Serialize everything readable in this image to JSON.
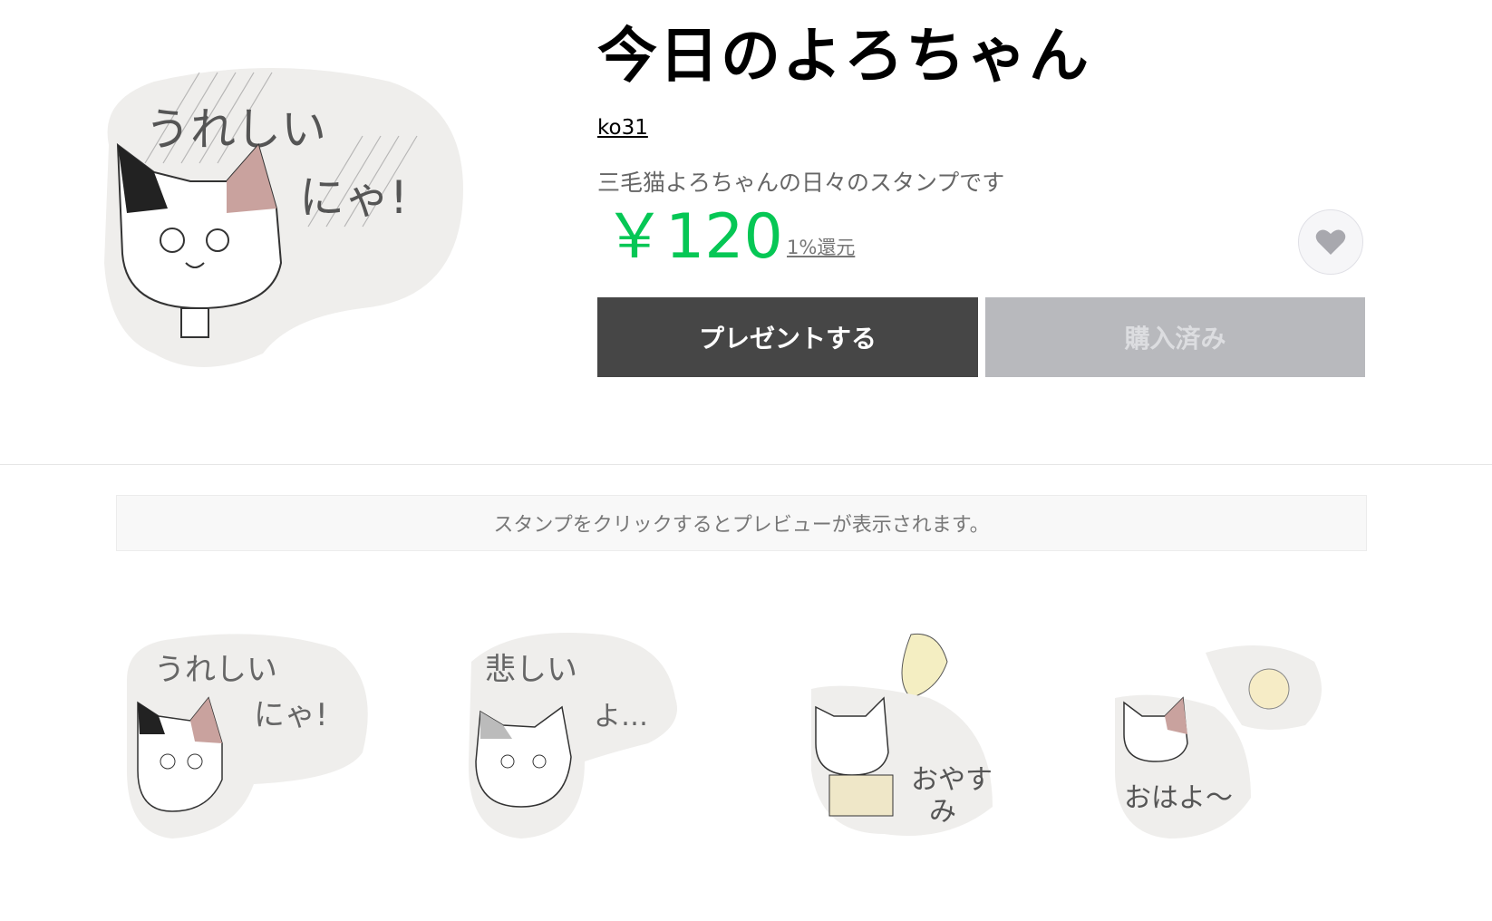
{
  "product": {
    "title": "今日のよろちゃん",
    "author": "ko31",
    "description": "三毛猫よろちゃんの日々のスタンプです",
    "price": "￥120",
    "rebate": "1%還元"
  },
  "actions": {
    "present_label": "プレゼントする",
    "purchased_label": "購入済み"
  },
  "preview_notice": "スタンプをクリックするとプレビューが表示されます。",
  "stamps": [
    {
      "name": "うれしいにゃ!",
      "caption_top": "うれしい",
      "caption_bottom": "にゃ!"
    },
    {
      "name": "悲しいよ…",
      "caption_top": "悲しい",
      "caption_bottom": "よ…"
    },
    {
      "name": "おやすみ",
      "caption_top": "おやす",
      "caption_bottom": "み"
    },
    {
      "name": "おはよ〜",
      "caption_top": "おはよ〜",
      "caption_bottom": ""
    }
  ],
  "colors": {
    "price_green": "#06c755",
    "present_button": "#464646",
    "purchased_button": "#b8b9bd"
  },
  "icons": [
    "heart-icon"
  ]
}
